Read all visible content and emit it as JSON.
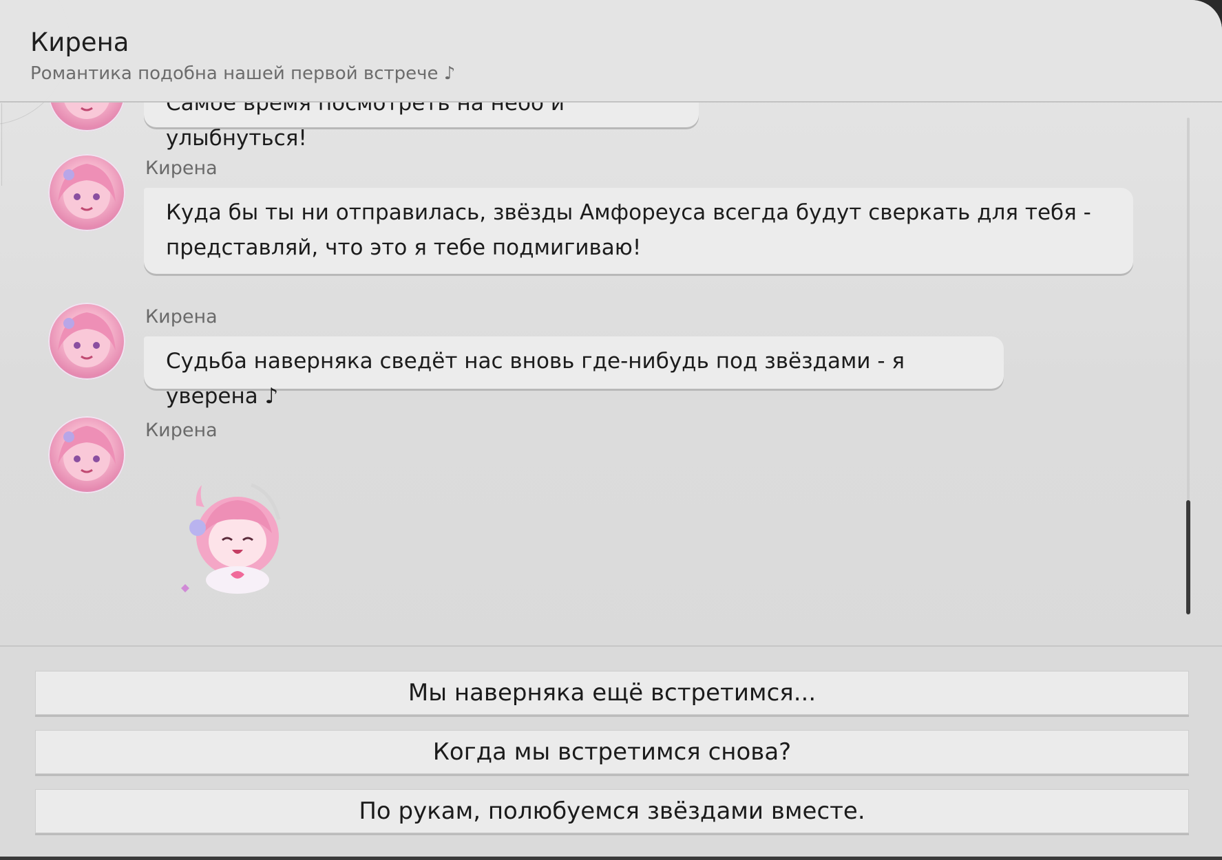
{
  "header": {
    "title": "Кирена",
    "subtitle": "Романтика подобна нашей первой встрече ♪"
  },
  "messages": [
    {
      "sender": "",
      "text": "Самое время посмотреть на небо и улыбнуться!"
    },
    {
      "sender": "Кирена",
      "text": "Куда бы ты ни отправилась, звёзды Амфореуса всегда будут сверкать для тебя - представляй, что это я тебе подмигиваю!"
    },
    {
      "sender": "Кирена",
      "text": "Судьба наверняка сведёт нас вновь где-нибудь под звёздами - я уверена ♪"
    },
    {
      "sender": "Кирена",
      "sticker": "chibi-heart-hands-sticker"
    }
  ],
  "replies": [
    {
      "label": "Мы наверняка ещё встретимся..."
    },
    {
      "label": "Когда мы встретимся снова?"
    },
    {
      "label": "По рукам, полюбуемся звёздами вместе."
    }
  ],
  "colors": {
    "background": "#dcdcdc",
    "bubble": "#ececec",
    "reply_button": "#ebebeb",
    "text": "#1c1c1c",
    "muted_text": "#6a6a6a",
    "avatar_hair": "#f5b3cb"
  },
  "icons": {
    "avatar": "character-avatar-icon",
    "sticker": "chibi-sticker-icon"
  }
}
